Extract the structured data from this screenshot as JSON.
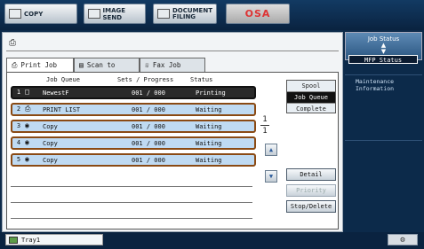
{
  "modes": {
    "copy": "COPY",
    "image_send": "IMAGE SEND",
    "document_filing_1": "DOCUMENT",
    "document_filing_2": "FILING",
    "osa": "OSA"
  },
  "tabs": {
    "print_job": "Print Job",
    "scan_to": "Scan to",
    "fax_job": "Fax Job"
  },
  "table": {
    "header": {
      "job_queue": "Job Queue",
      "sets_progress": "Sets / Progress",
      "status": "Status"
    },
    "rows": [
      {
        "num": "1",
        "name": "NewestF",
        "sets": "001 / 000",
        "status": "Printing"
      },
      {
        "num": "2",
        "name": "PRINT LIST",
        "sets": "001 / 000",
        "status": "Waiting"
      },
      {
        "num": "3",
        "name": "Copy",
        "sets": "001 / 000",
        "status": "Waiting"
      },
      {
        "num": "4",
        "name": "Copy",
        "sets": "001 / 000",
        "status": "Waiting"
      },
      {
        "num": "5",
        "name": "Copy",
        "sets": "001 / 000",
        "status": "Waiting"
      }
    ]
  },
  "pager": {
    "current": "1",
    "total": "1"
  },
  "spool": {
    "spool": "Spool",
    "job_queue": "Job Queue",
    "complete": "Complete"
  },
  "actions": {
    "detail": "Detail",
    "priority": "Priority",
    "stop_delete": "Stop/Delete"
  },
  "right_panel": {
    "job_status": "Job Status",
    "mfp_status": "MFP Status",
    "maintenance_1": "Maintenance",
    "maintenance_2": "Information"
  },
  "bottom": {
    "tray": "Tray1"
  },
  "icons": {
    "printer": "printer-icon",
    "scanner": "scanner-icon",
    "fax": "fax-icon",
    "up": "arrow-up-icon",
    "down": "arrow-down-icon",
    "settings": "gear-icon"
  }
}
